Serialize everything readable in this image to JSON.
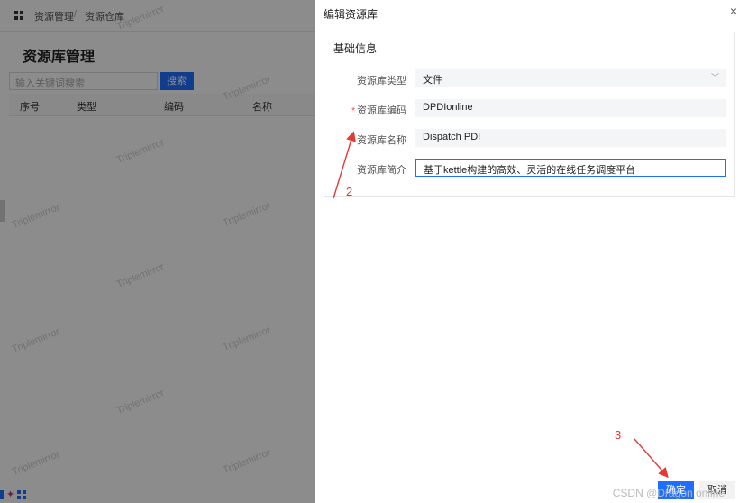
{
  "background": {
    "breadcrumb": [
      "资源管理",
      "/",
      "资源仓库"
    ],
    "page_title": "资源库管理",
    "search": {
      "placeholder": "输入关键词搜索",
      "button_label": "搜索"
    },
    "table_headers": [
      "序号",
      "类型",
      "编码",
      "名称"
    ],
    "watermark_text": "Triplemirror"
  },
  "drawer": {
    "title": "编辑资源库",
    "close_symbol": "×",
    "section_title": "基础信息",
    "fields": [
      {
        "label": "资源库类型",
        "value": "文件",
        "required": false
      },
      {
        "label": "资源库编码",
        "value": "DPDIonline",
        "required": true
      },
      {
        "label": "资源库名称",
        "value": "Dispatch PDI",
        "required": true
      },
      {
        "label": "资源库简介",
        "value": "基于kettle构建的高效、灵活的在线任务调度平台",
        "required": false
      }
    ],
    "required_mark": "*",
    "ok_label": "确定",
    "cancel_label": "取消"
  },
  "annotations": {
    "step2": "2",
    "step3": "3"
  },
  "csdn_watermark": "CSDN @Dragon online",
  "colors": {
    "primary": "#1e6fff",
    "annotation": "#e53935",
    "required": "#f04545"
  }
}
